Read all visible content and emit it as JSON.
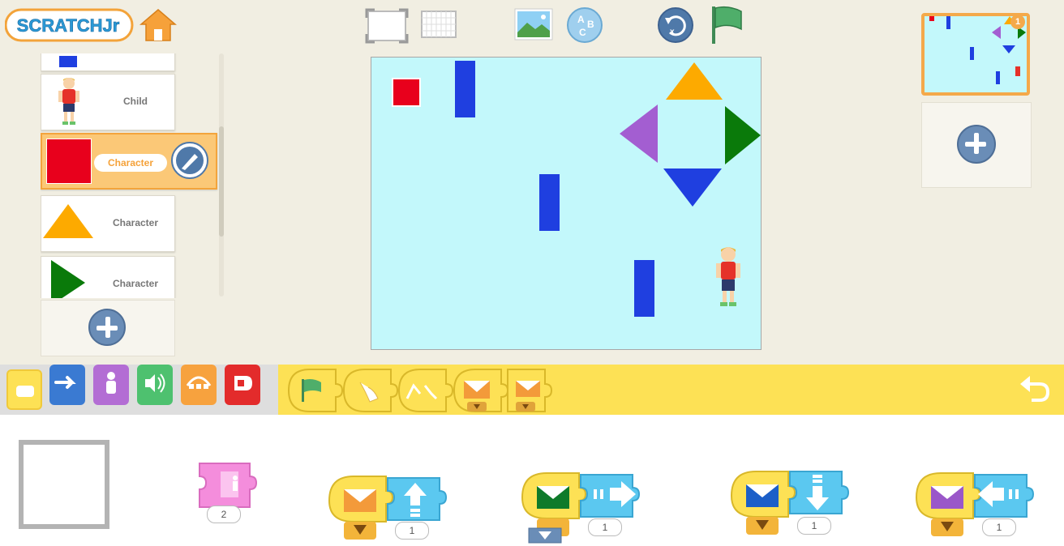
{
  "app": {
    "logo_text": "SCRATCHJr"
  },
  "sprites": [
    {
      "label": "",
      "type": "blue-rect"
    },
    {
      "label": "Child",
      "type": "child"
    },
    {
      "label": "Character",
      "type": "red-square",
      "selected": true
    },
    {
      "label": "Character",
      "type": "orange-triangle"
    },
    {
      "label": "Character",
      "type": "green-triangle"
    }
  ],
  "page": {
    "number": "1"
  },
  "script": {
    "pink_block_value": "2",
    "orange_up_value": "1",
    "green_right_value": "1",
    "blue_down_value": "1",
    "purple_left_value": "1"
  },
  "colors": {
    "stage": "#c3f8fb",
    "palette": "#fde155",
    "red": "#e8001c",
    "blue": "#1f3fe0",
    "orange": "#fdaa00",
    "green": "#0a7a0a",
    "purple": "#a35ed1"
  }
}
